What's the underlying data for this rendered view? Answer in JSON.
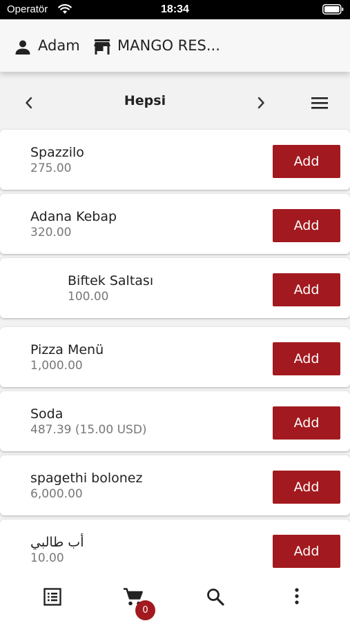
{
  "status_bar": {
    "carrier": "Operatör",
    "time": "18:34"
  },
  "header": {
    "user_name": "Adam",
    "store_name": "MANGO RES..."
  },
  "category_bar": {
    "title": "Hepsi"
  },
  "products": [
    {
      "name": "Spazzilo",
      "price": "275.00",
      "button": "Add"
    },
    {
      "name": "Adana Kebap",
      "price": "320.00",
      "button": "Add"
    },
    {
      "name": "Biftek Saltası",
      "price": "100.00",
      "button": "Add"
    },
    {
      "name": "Pizza Menü",
      "price": "1,000.00",
      "button": "Add"
    },
    {
      "name": "Soda",
      "price": "487.39 (15.00 USD)",
      "button": "Add"
    },
    {
      "name": "spagethi bolonez",
      "price": "6,000.00",
      "button": "Add"
    },
    {
      "name": "أب طالبي",
      "price": "10.00",
      "button": "Add"
    }
  ],
  "bottom_nav": {
    "cart_count": "0"
  },
  "icons": {
    "user": "person-icon",
    "store": "store-icon",
    "prev": "chevron-left-icon",
    "next": "chevron-right-icon",
    "menu": "hamburger-menu-icon",
    "orders": "list-icon",
    "cart": "shopping-cart-icon",
    "search": "search-icon",
    "more": "more-vertical-icon"
  },
  "colors": {
    "accent": "#a21a1f",
    "price_text": "#777777",
    "background": "#f2f2f2"
  }
}
